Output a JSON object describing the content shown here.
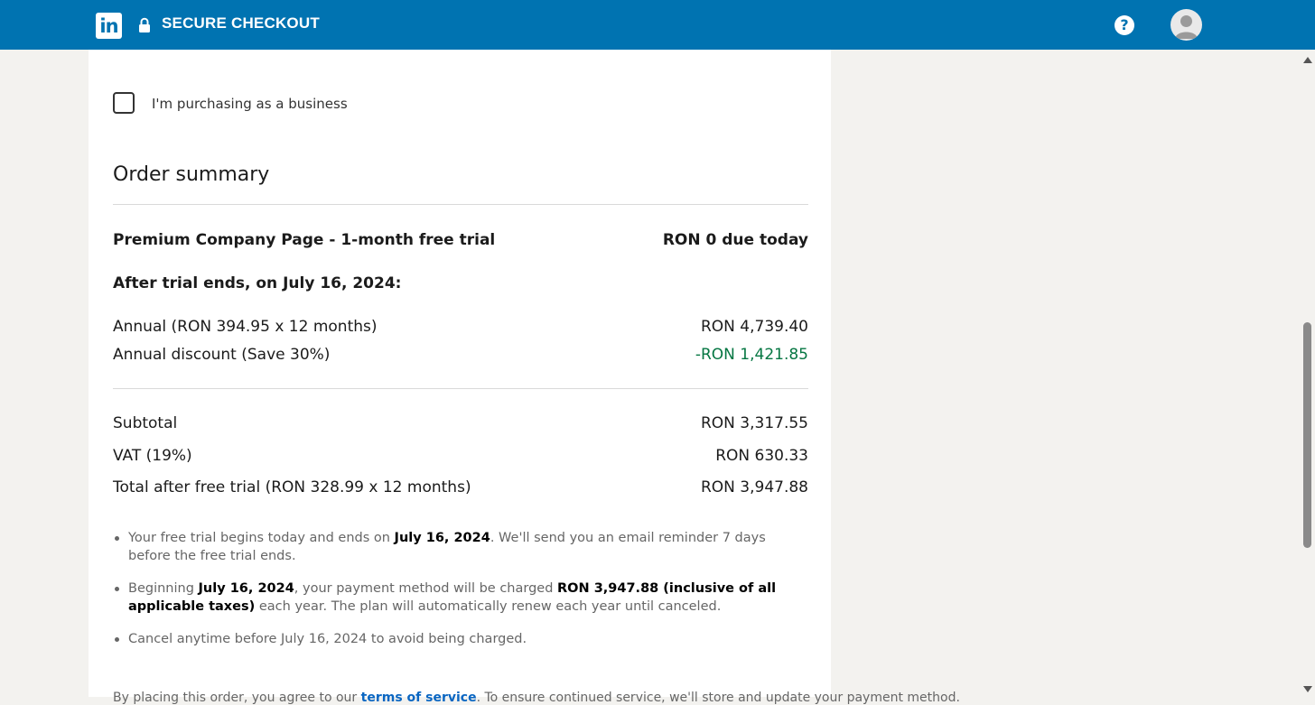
{
  "header": {
    "logo_text": "in",
    "title": "SECURE CHECKOUT",
    "help_symbol": "?",
    "icons": [
      "linkedin-logo",
      "lock-icon",
      "help-icon",
      "avatar"
    ],
    "bar_color": "#0073b1"
  },
  "business": {
    "checkbox_label": "I'm purchasing as a business",
    "checked": false
  },
  "order_summary": {
    "title": "Order summary",
    "product": {
      "label": "Premium Company Page - 1-month free trial",
      "value": "RON 0 due today"
    },
    "after_trial": "After trial ends, on July 16, 2024:",
    "annual": {
      "label": "Annual (RON 394.95 x 12 months)",
      "value": "RON 4,739.40"
    },
    "discount": {
      "label": "Annual discount (Save 30%)",
      "value": "-RON 1,421.85",
      "color": "#057642"
    },
    "subtotal": {
      "label": "Subtotal",
      "value": "RON 3,317.55"
    },
    "vat": {
      "label": "VAT (19%)",
      "value": "RON 630.33"
    },
    "total": {
      "label": "Total after free trial (RON 328.99 x 12 months)",
      "value": "RON 3,947.88"
    }
  },
  "notes": [
    {
      "a": "Your free trial begins today and ends on ",
      "b": "July 16, 2024",
      "c": ". We'll send you an email reminder 7 days before the free trial ends."
    },
    {
      "a": "Beginning ",
      "b": "July 16, 2024",
      "c": ", your payment method will be charged ",
      "d": "RON 3,947.88 (inclusive of all applicable taxes)",
      "e": " each year. The plan will automatically renew each year until canceled."
    },
    {
      "a": "Cancel anytime before July 16, 2024 to avoid being charged."
    }
  ],
  "footer": {
    "prefix": "By placing this order, you agree to our ",
    "link": "terms of service",
    "suffix": ". To ensure continued service, we'll store and update your payment method."
  }
}
